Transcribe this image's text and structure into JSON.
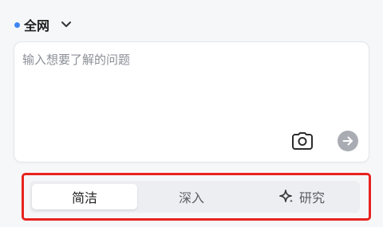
{
  "scope": {
    "label": "全网"
  },
  "input": {
    "placeholder": "输入想要了解的问题"
  },
  "modes": [
    {
      "label": "简洁",
      "selected": true
    },
    {
      "label": "深入",
      "selected": false
    },
    {
      "label": "研究",
      "selected": false
    }
  ],
  "icons": {
    "scope_dot": "dot-icon",
    "dropdown": "chevron-down-icon",
    "camera": "camera-icon",
    "send": "arrow-right-icon",
    "research": "sparkle-icon"
  },
  "colors": {
    "accent": "#3e86f5",
    "highlight": "#e8231f",
    "send_bg": "#a9acb2"
  }
}
